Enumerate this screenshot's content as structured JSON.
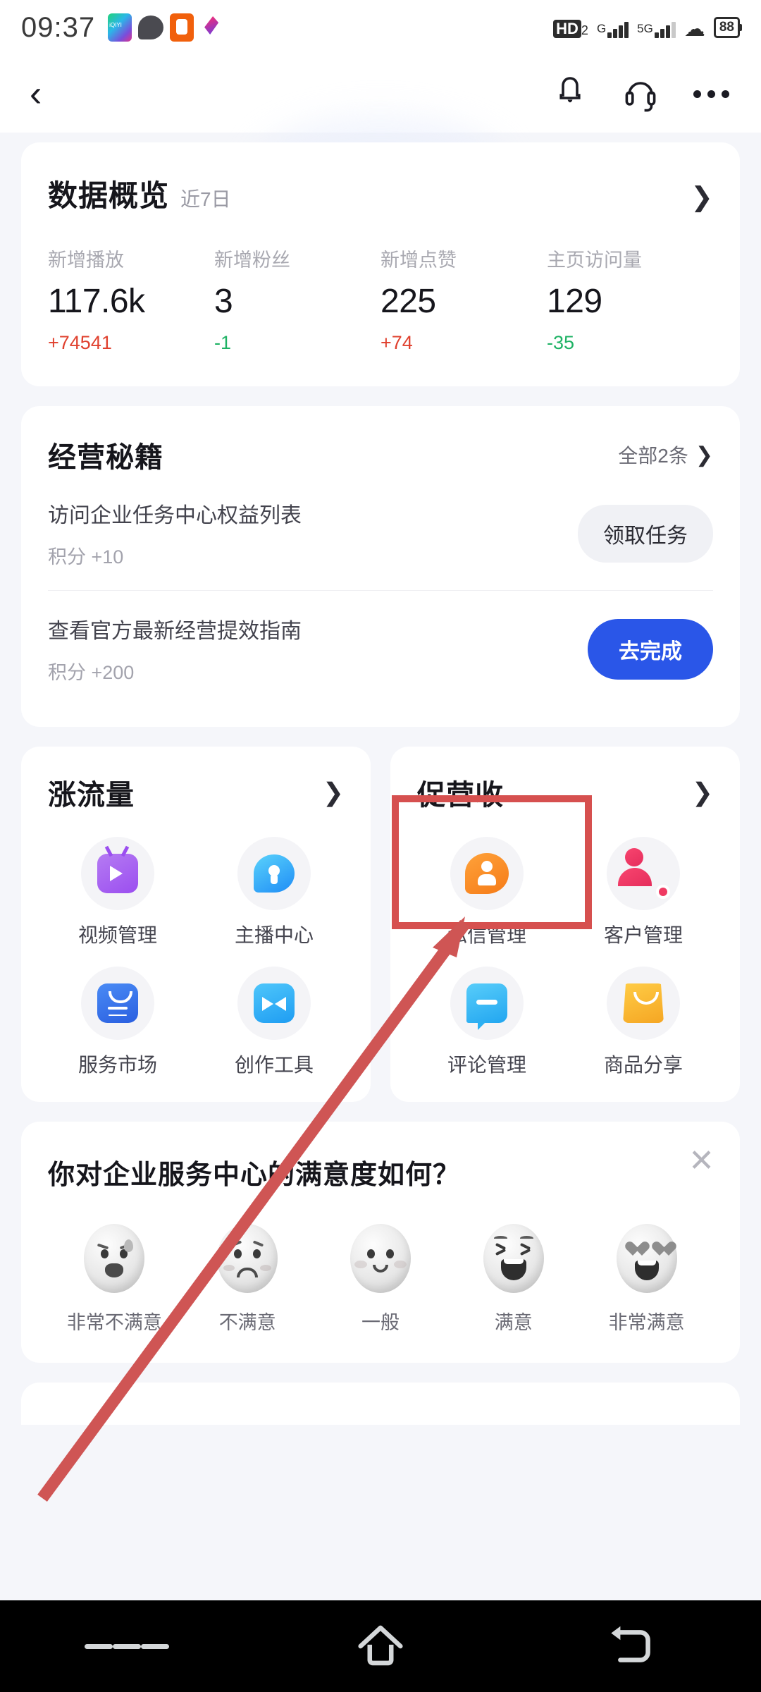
{
  "status_bar": {
    "time": "09:37",
    "app_icons": [
      "iqiyi-icon",
      "chat-bubble-icon",
      "orange-app-icon",
      "pink-app-icon"
    ],
    "hd_label": "HD",
    "hd_sub": "2",
    "sim1_label": "G",
    "sim2_label": "5G",
    "wifi_icon": "wifi-icon",
    "battery": "88"
  },
  "header": {
    "back_icon": "back-chevron-icon",
    "bell_icon": "bell-icon",
    "headset_icon": "headset-icon",
    "more_icon": "more-options-icon"
  },
  "overview": {
    "title": "数据概览",
    "subtitle": "近7日",
    "arrow": "❯",
    "metrics": [
      {
        "label": "新增播放",
        "value": "117.6k",
        "delta": "+74541",
        "dir": "up"
      },
      {
        "label": "新增粉丝",
        "value": "3",
        "delta": "-1",
        "dir": "down"
      },
      {
        "label": "新增点赞",
        "value": "225",
        "delta": "+74",
        "dir": "up"
      },
      {
        "label": "主页访问量",
        "value": "129",
        "delta": "-35",
        "dir": "down"
      }
    ]
  },
  "tips": {
    "title": "经营秘籍",
    "all_label": "全部2条",
    "all_chevron": "❯",
    "tasks": [
      {
        "title": "访问企业任务中心权益列表",
        "points": "积分 +10",
        "button": "领取任务",
        "style": "ghost"
      },
      {
        "title": "查看官方最新经营提效指南",
        "points": "积分 +200",
        "button": "去完成",
        "style": "primary"
      }
    ]
  },
  "grid_cards": [
    {
      "title": "涨流量",
      "arrow": "❯",
      "items": [
        {
          "label": "视频管理",
          "icon": "video-management-icon"
        },
        {
          "label": "主播中心",
          "icon": "anchor-center-icon"
        },
        {
          "label": "服务市场",
          "icon": "service-market-icon"
        },
        {
          "label": "创作工具",
          "icon": "creation-tools-icon"
        }
      ]
    },
    {
      "title": "促营收",
      "arrow": "❯",
      "items": [
        {
          "label": "私信管理",
          "icon": "direct-message-icon"
        },
        {
          "label": "客户管理",
          "icon": "customer-management-icon"
        },
        {
          "label": "评论管理",
          "icon": "comment-management-icon"
        },
        {
          "label": "商品分享",
          "icon": "product-share-icon"
        }
      ]
    }
  ],
  "survey": {
    "question": "你对企业服务中心的满意度如何？",
    "close_icon": "✕",
    "options": [
      {
        "label": "非常不满意",
        "face": "crying-face"
      },
      {
        "label": "不满意",
        "face": "sad-face"
      },
      {
        "label": "一般",
        "face": "neutral-face"
      },
      {
        "label": "满意",
        "face": "happy-face"
      },
      {
        "label": "非常满意",
        "face": "heart-eyes-face"
      }
    ]
  },
  "annotation": {
    "box_color": "#d6504f",
    "arrow_color": "#cf5554"
  },
  "nav_bar": {
    "menu_icon": "menu-icon",
    "home_icon": "home-icon",
    "back_icon": "back-icon"
  }
}
